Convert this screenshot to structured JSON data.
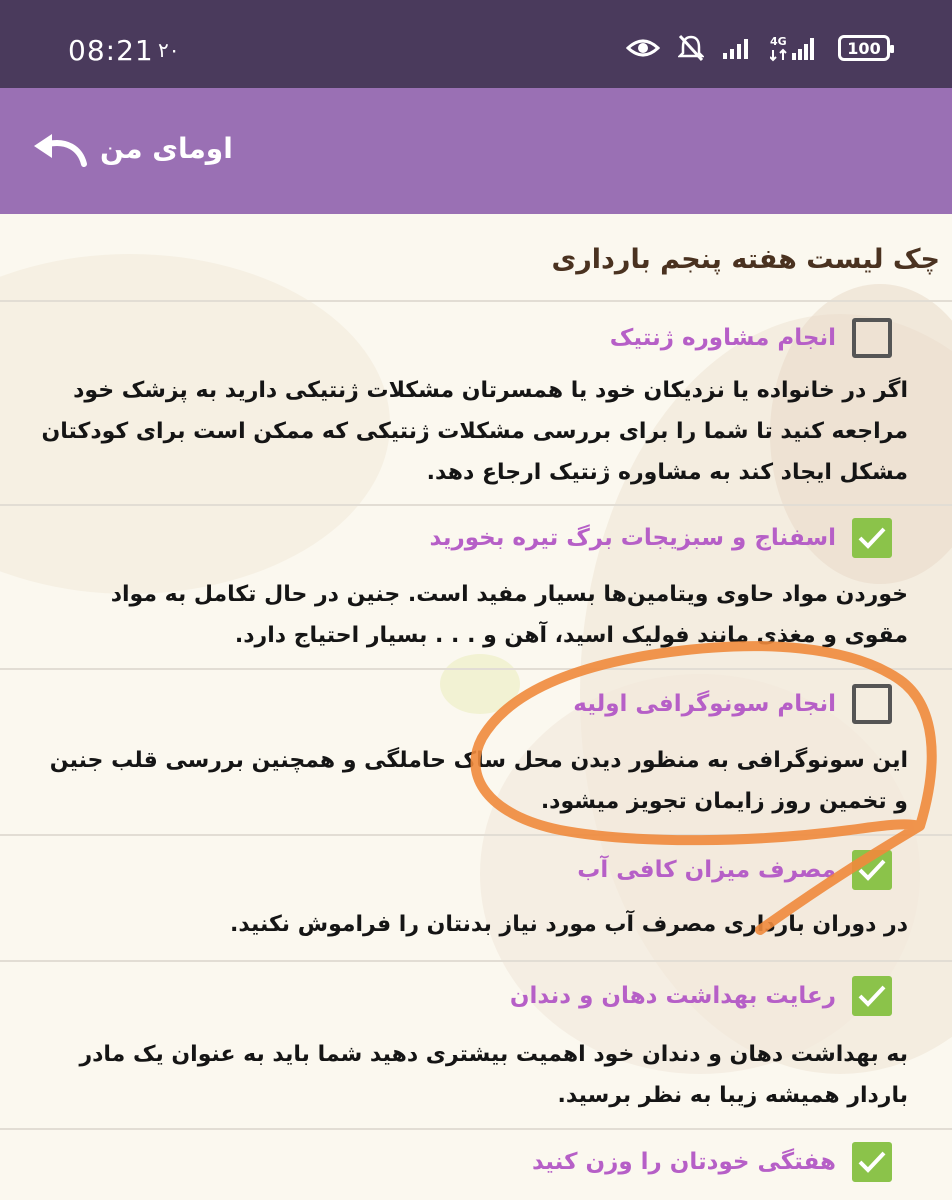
{
  "status_bar": {
    "time": "08:21",
    "date": "۲۰",
    "battery": "100"
  },
  "app_bar": {
    "title": "اومای من"
  },
  "page": {
    "title": "چک لیست هفته پنجم بارداری"
  },
  "items": [
    {
      "title": "انجام مشاوره ژنتیک",
      "checked": false,
      "desc": "اگر در خانواده یا نزدیکان خود یا همسرتان مشکلات ژنتیکی دارید به پزشک خود مراجعه کنید تا شما را برای بررسی مشکلات ژنتیکی که ممکن است برای کودکتان مشکل ایجاد کند به مشاوره ژنتیک ارجاع دهد."
    },
    {
      "title": "اسفناج و سبزیجات برگ تیره بخورید",
      "checked": true,
      "desc": "خوردن مواد حاوی ویتامین‌ها بسیار مفید است. جنین در حال تکامل به مواد مقوی و مغذی مانند فولیک اسید، آهن و . . .  بسیار احتیاج دارد."
    },
    {
      "title": "انجام سونوگرافی اولیه",
      "checked": false,
      "desc": "این سونوگرافی به منظور دیدن محل ساک حاملگی و همچنین بررسی قلب جنین و تخمین روز زایمان تجویز میشود."
    },
    {
      "title": "مصرف میزان کافی آب",
      "checked": true,
      "desc": "در دوران بارداری مصرف آب مورد نیاز بدنتان را فراموش نکنید."
    },
    {
      "title": "رعایت بهداشت دهان و دندان",
      "checked": true,
      "desc": "به بهداشت دهان و دندان خود اهمیت بیشتری دهید شما باید به عنوان یک مادر باردار همیشه زیبا به نظر برسید."
    },
    {
      "title": "هفتگی خودتان را وزن کنید",
      "checked": true,
      "desc": ""
    }
  ],
  "colors": {
    "status_bar": "#4a3a5c",
    "app_bar": "#9a70b4",
    "item_title": "#b65fc7",
    "checkbox_checked": "#8bc34a",
    "annotation": "#f08a3c"
  }
}
